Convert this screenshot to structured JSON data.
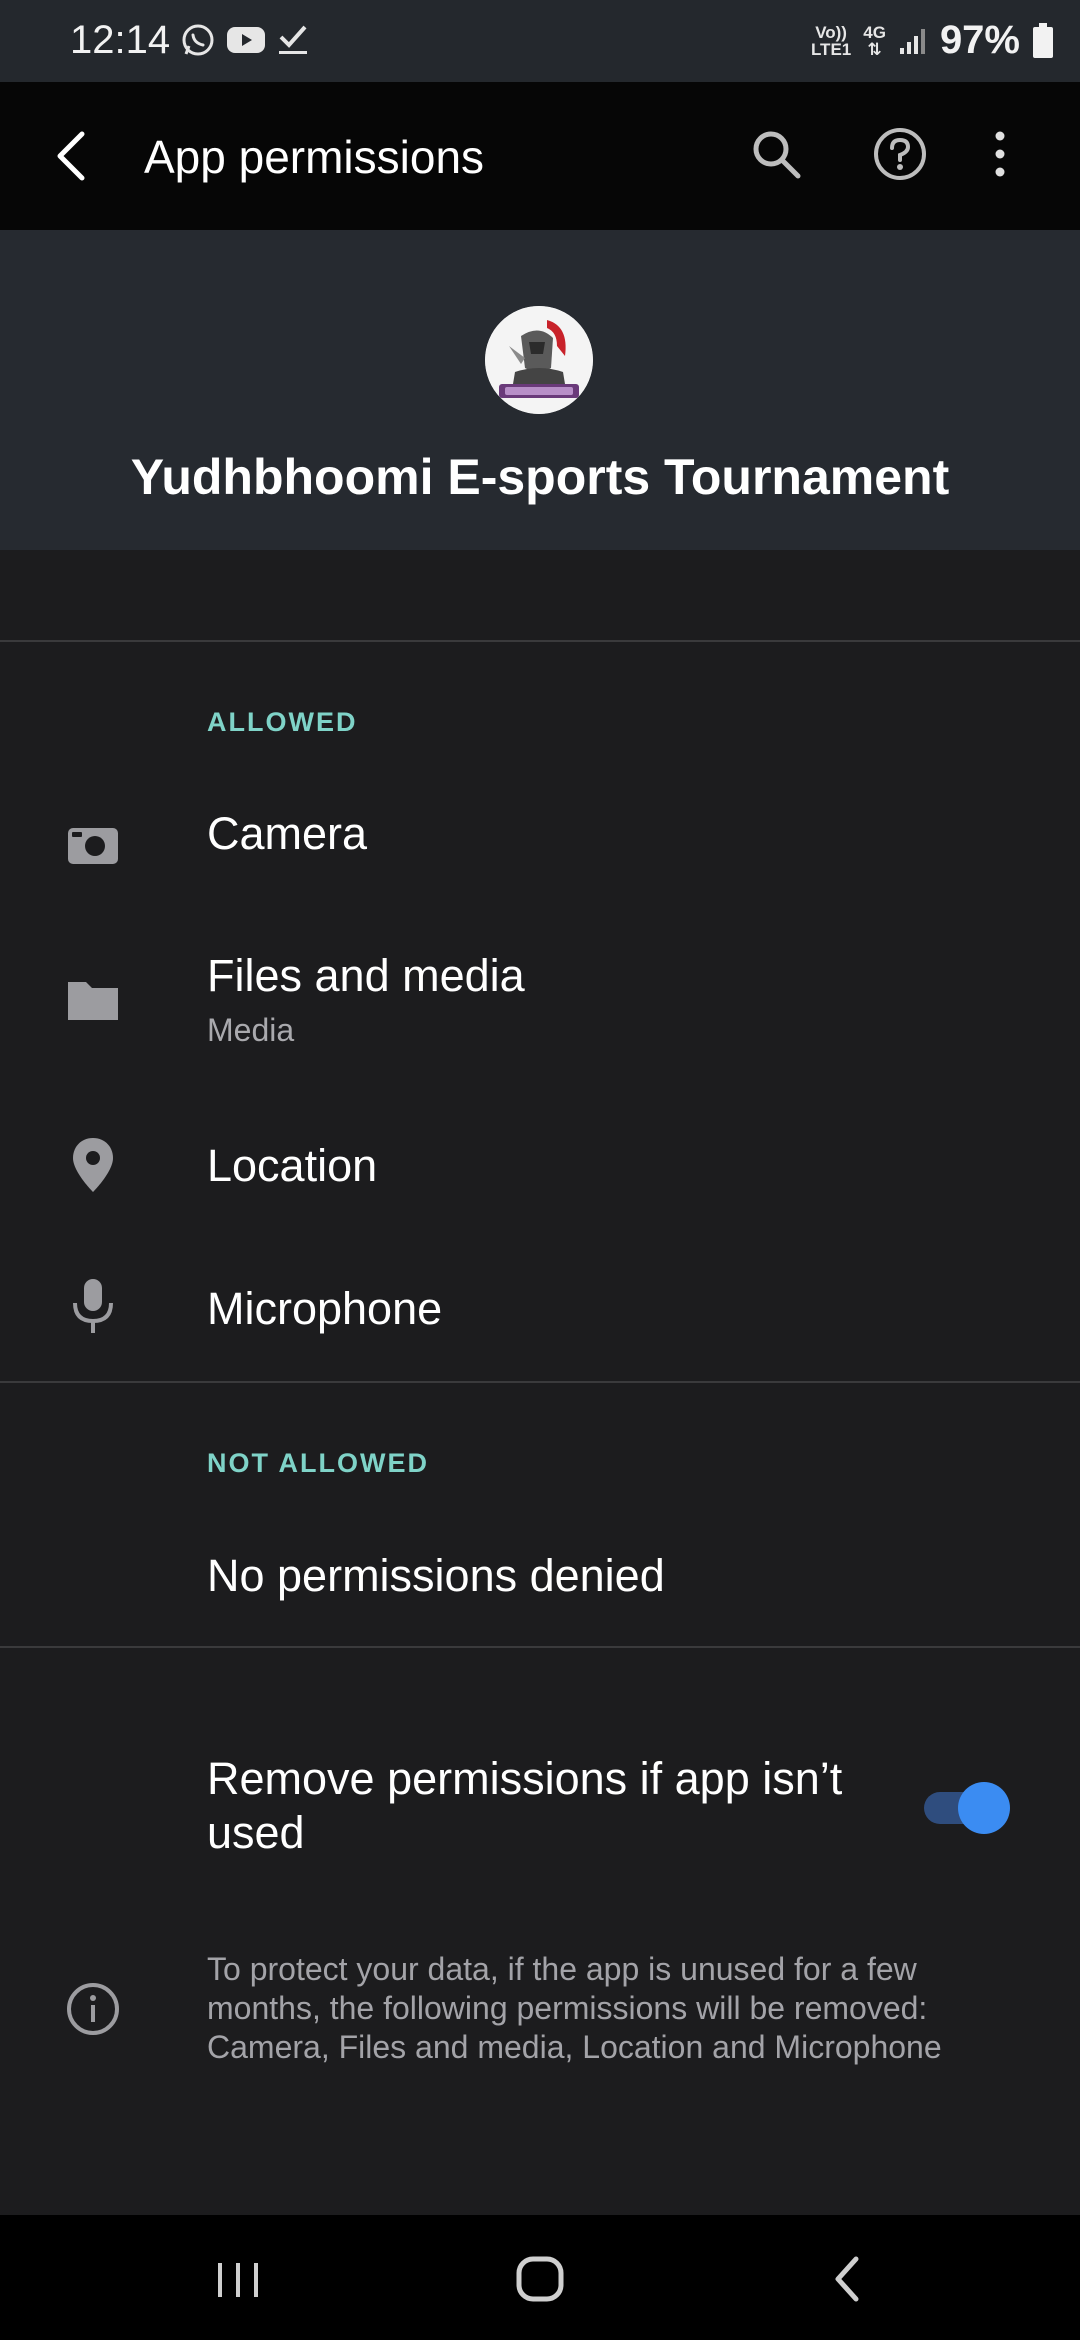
{
  "status_bar": {
    "time": "12:14",
    "notification_icons": [
      "whatsapp-icon",
      "youtube-icon",
      "checkmark-icon"
    ],
    "network_top": "Vo))",
    "network_bottom": "LTE1",
    "network_type": "4G",
    "battery_percent": "97%"
  },
  "app_bar": {
    "title": "App permissions",
    "icons": [
      "back-arrow-icon",
      "search-icon",
      "help-icon",
      "more-vert-icon"
    ]
  },
  "header": {
    "app_name": "Yudhbhoomi E-sports Tournament"
  },
  "allowed": {
    "label": "ALLOWED",
    "items": [
      {
        "icon": "camera-icon",
        "title": "Camera"
      },
      {
        "icon": "folder-icon",
        "title": "Files and media",
        "subtitle": "Media"
      },
      {
        "icon": "location-pin-icon",
        "title": "Location"
      },
      {
        "icon": "microphone-icon",
        "title": "Microphone"
      }
    ]
  },
  "not_allowed": {
    "label": "NOT ALLOWED",
    "empty_text": "No permissions denied"
  },
  "auto_revoke": {
    "title": "Remove permissions if app isn’t used",
    "enabled": true,
    "info_text": "To protect your data, if the app is unused for a few months, the following permissions will be removed: Camera, Files and media, Location and Microphone"
  },
  "colors": {
    "background": "#1c1c1e",
    "header_background": "#262a30",
    "section_label": "#7fd3c8",
    "toggle_on": "#3b8cf2"
  }
}
